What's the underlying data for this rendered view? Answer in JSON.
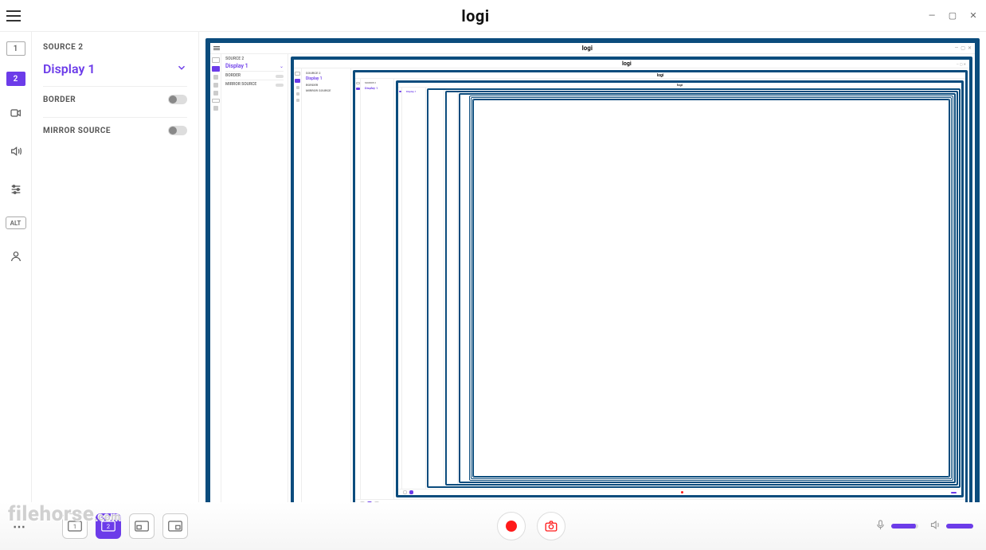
{
  "header": {
    "logo": "logi"
  },
  "sidebar": {
    "source_label": "SOURCE 2",
    "source_name": "Display 1",
    "border_label": "BORDER",
    "mirror_label": "MIRROR SOURCE"
  },
  "rail": {
    "scene1": "1",
    "scene2": "2",
    "alt": "ALT"
  },
  "bottom": {
    "scene1": "1",
    "scene2": "2"
  },
  "watermark": "filehorse",
  "watermark_suffix": ".com"
}
